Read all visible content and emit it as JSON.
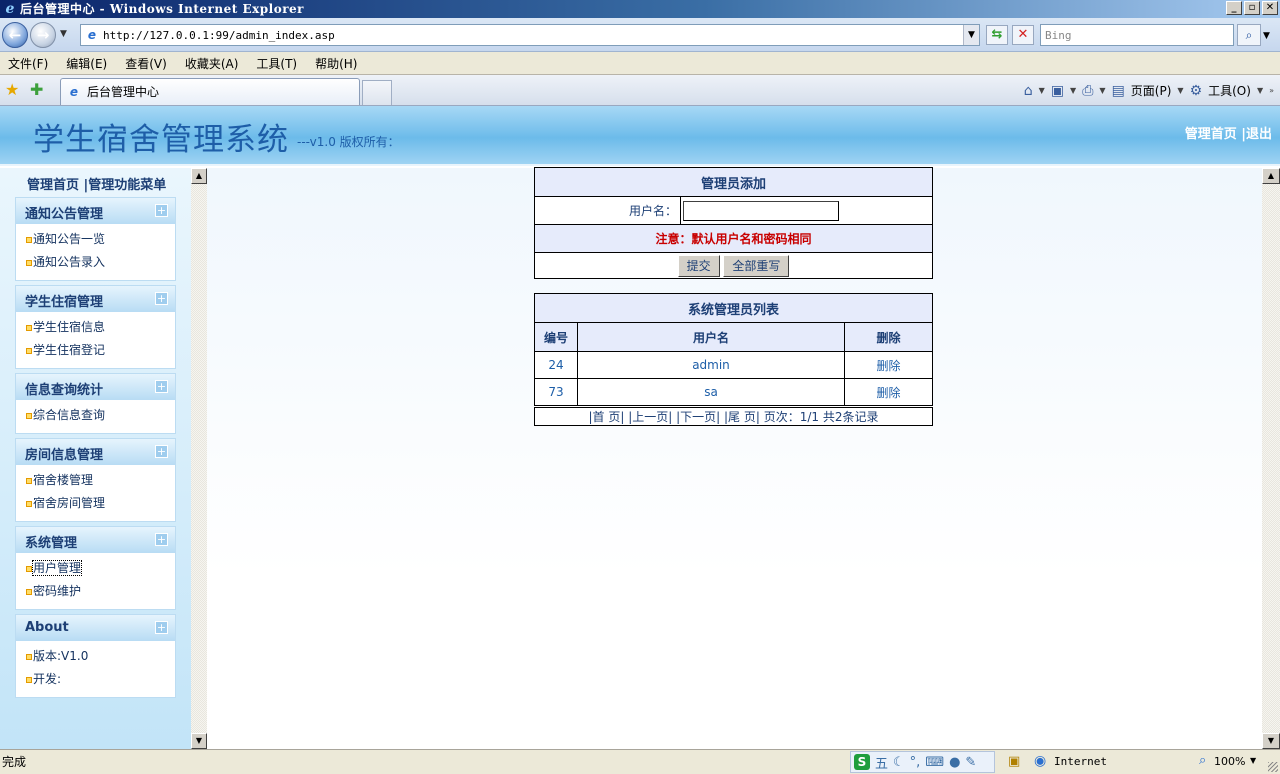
{
  "window": {
    "title": "后台管理中心 - Windows Internet Explorer",
    "buttons": [
      "_",
      "▫",
      "✕"
    ]
  },
  "browser": {
    "address": "http://127.0.0.1:99/admin_index.asp",
    "search_placeholder": "Bing",
    "menu": [
      "文件(F)",
      "编辑(E)",
      "查看(V)",
      "收藏夹(A)",
      "工具(T)",
      "帮助(H)"
    ],
    "tab_label": "后台管理中心",
    "cmd_page": "页面(P)",
    "cmd_tools": "工具(O)"
  },
  "site": {
    "title": "学生宿舍管理系统",
    "subtitle": "---v1.0 版权所有：",
    "header_links": [
      "管理首页",
      "退出"
    ]
  },
  "sidebar": {
    "top": "管理首页 |管理功能菜单",
    "groups": [
      {
        "title": "通知公告管理",
        "items": [
          "通知公告一览",
          "通知公告录入"
        ]
      },
      {
        "title": "学生住宿管理",
        "items": [
          "学生住宿信息",
          "学生住宿登记"
        ]
      },
      {
        "title": "信息查询统计",
        "items": [
          "综合信息查询"
        ]
      },
      {
        "title": "房间信息管理",
        "items": [
          "宿舍楼管理",
          "宿舍房间管理"
        ]
      },
      {
        "title": "系统管理",
        "items": [
          "用户管理",
          "密码维护"
        ]
      },
      {
        "title": "About",
        "items": [
          "版本:V1.0",
          "开发:"
        ]
      }
    ]
  },
  "add_form": {
    "title": "管理员添加",
    "username_label": "用户名：",
    "username_value": "",
    "note": "注意：默认用户名和密码相同",
    "submit": "提交",
    "reset": "全部重写"
  },
  "admin_list": {
    "title": "系统管理员列表",
    "columns": [
      "编号",
      "用户名",
      "删除"
    ],
    "rows": [
      {
        "id": "24",
        "username": "admin",
        "action": "删除"
      },
      {
        "id": "73",
        "username": "sa",
        "action": "删除"
      }
    ],
    "pager": "|首  页| |上一页| |下一页| |尾  页|  页次：1/1 共2条记录"
  },
  "status": {
    "text": "完成",
    "zone": "Internet",
    "zoom": "100%"
  },
  "colors": {
    "header_blue": "#6cbbea",
    "title_blue": "#1e5ea8",
    "note_red": "#c80000",
    "table_header_bg": "#e6ebfb"
  }
}
